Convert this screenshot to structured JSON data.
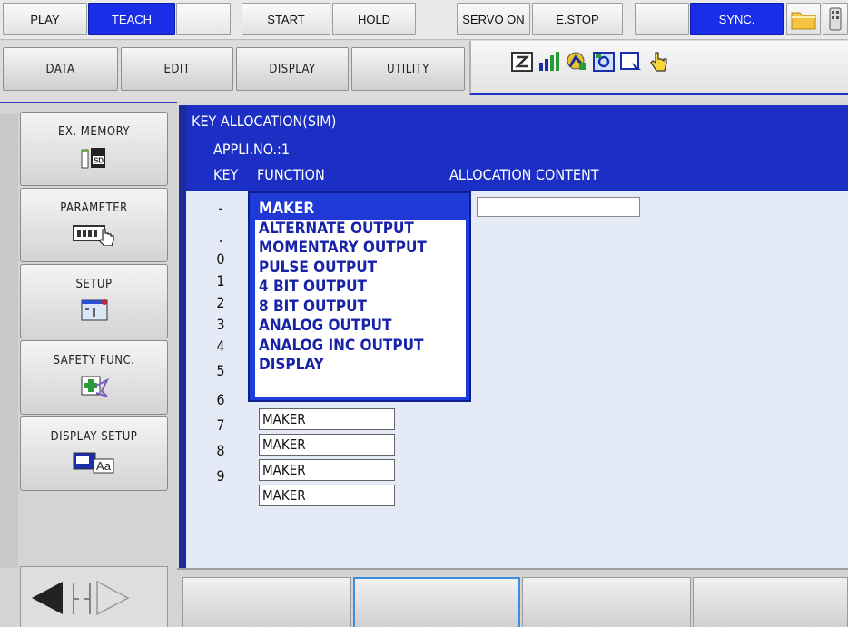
{
  "topbar": {
    "play": "PLAY",
    "teach": "TEACH",
    "start": "START",
    "hold": "HOLD",
    "servo_on": "SERVO ON",
    "estop": "E.STOP",
    "sync": "SYNC."
  },
  "menu": {
    "data": "DATA",
    "edit": "EDIT",
    "display": "DISPLAY",
    "utility": "UTILITY"
  },
  "sidemenu": {
    "ex_memory": "EX. MEMORY",
    "parameter": "PARAMETER",
    "setup": "SETUP",
    "safety": "SAFETY FUNC.",
    "display_setup": "DISPLAY SETUP"
  },
  "icons": {
    "sd": "SD",
    "aa": "Aa"
  },
  "screen": {
    "title": "KEY ALLOCATION(SIM)",
    "appli": "APPLI.NO.:1",
    "col_key": "KEY",
    "col_function": "FUNCTION",
    "col_alloc": "ALLOCATION CONTENT",
    "rows": [
      {
        "key": "-",
        "function": ""
      },
      {
        "key": ".",
        "function": ""
      },
      {
        "key": "0",
        "function": ""
      },
      {
        "key": "1",
        "function": ""
      },
      {
        "key": "2",
        "function": ""
      },
      {
        "key": "3",
        "function": ""
      },
      {
        "key": "4",
        "function": ""
      },
      {
        "key": "5",
        "function": ""
      },
      {
        "key": "6",
        "function": "MAKER"
      },
      {
        "key": "7",
        "function": "MAKER"
      },
      {
        "key": "8",
        "function": "MAKER"
      },
      {
        "key": "9",
        "function": "MAKER"
      }
    ]
  },
  "popup": {
    "options": [
      "MAKER",
      "ALTERNATE OUTPUT",
      "MOMENTARY OUTPUT",
      "PULSE OUTPUT",
      "4 BIT OUTPUT",
      "8 BIT OUTPUT",
      "ANALOG OUTPUT",
      "ANALOG INC OUTPUT",
      "DISPLAY"
    ],
    "selected_index": 0
  },
  "colors": {
    "teach_blue": "#1a2ee8",
    "header_blue": "#1c2fc4",
    "option_text": "#1823a8"
  }
}
